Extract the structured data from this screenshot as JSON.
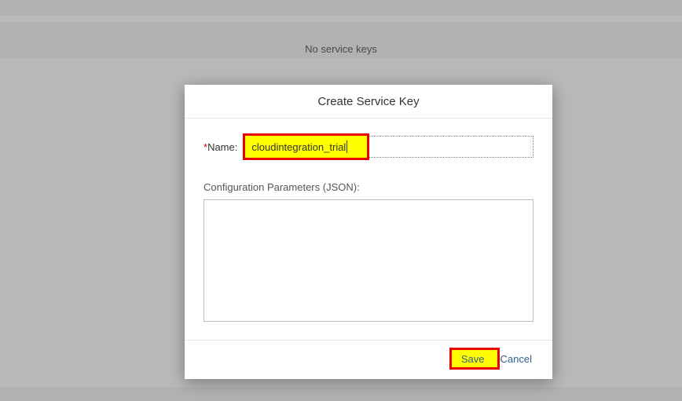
{
  "background": {
    "empty_state_text": "No service keys"
  },
  "dialog": {
    "title": "Create Service Key",
    "name": {
      "label": "Name:",
      "required_marker": "*",
      "value": "cloudintegration_trial"
    },
    "config": {
      "label": "Configuration Parameters (JSON):",
      "value": ""
    },
    "buttons": {
      "save": "Save",
      "cancel": "Cancel"
    }
  }
}
